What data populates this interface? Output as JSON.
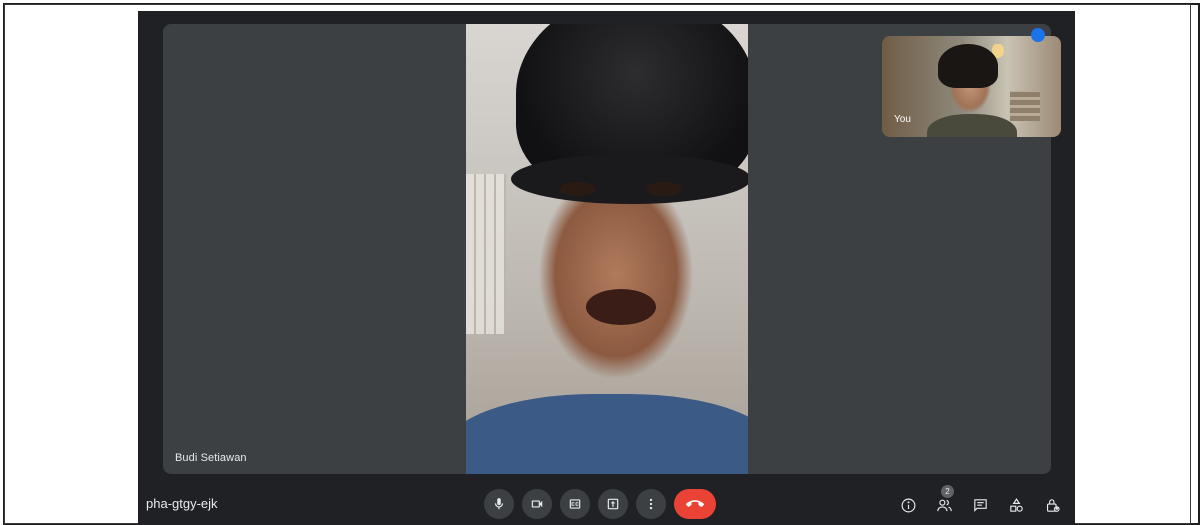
{
  "meeting": {
    "code": "pha-gtgy-ejk",
    "participant_count": "2"
  },
  "main_tile": {
    "participant_name": "Budi Setiawan"
  },
  "self_tile": {
    "label": "You"
  },
  "controls": [
    {
      "name": "microphone",
      "icon": "mic-icon"
    },
    {
      "name": "camera",
      "icon": "videocam-icon"
    },
    {
      "name": "captions",
      "icon": "closed-caption-icon"
    },
    {
      "name": "present",
      "icon": "present-to-all-icon"
    },
    {
      "name": "more-options",
      "icon": "more-vert-icon"
    },
    {
      "name": "leave-call",
      "icon": "call-end-icon"
    }
  ],
  "right_panel": [
    {
      "name": "meeting-details",
      "icon": "info-icon"
    },
    {
      "name": "people",
      "icon": "people-icon"
    },
    {
      "name": "chat",
      "icon": "chat-icon"
    },
    {
      "name": "activities",
      "icon": "shapes-icon"
    },
    {
      "name": "host-controls",
      "icon": "lock-person-icon"
    }
  ],
  "colors": {
    "background": "#202124",
    "tile": "#3c4043",
    "end_call": "#ea4335",
    "accent": "#1a73e8"
  }
}
